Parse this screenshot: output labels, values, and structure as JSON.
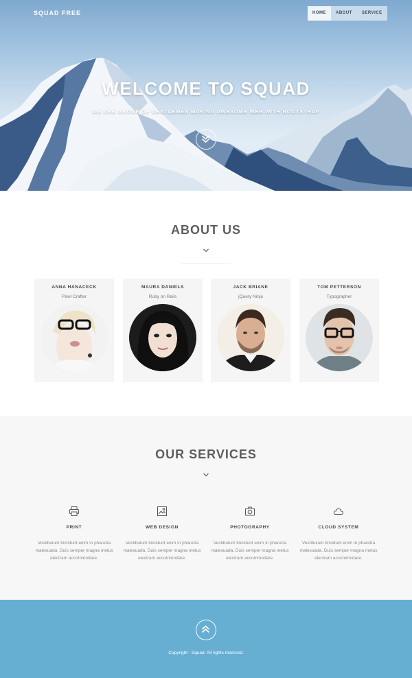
{
  "header": {
    "brand": "SQUAD FREE",
    "nav": [
      {
        "label": "HOME",
        "active": true
      },
      {
        "label": "ABOUT",
        "active": false
      },
      {
        "label": "SERVICE",
        "active": false
      }
    ]
  },
  "hero": {
    "title": "WELCOME TO SQUAD",
    "subtitle": "WE ARE GROUP OF GENTLEMEN MAKING AWESOME WEB WITH BOOTSTRAP",
    "scroll_icon": "double-chevron-down-icon"
  },
  "about": {
    "title": "ABOUT US",
    "team": [
      {
        "name": "ANNA HANACECK",
        "role": "Pixel Crafter"
      },
      {
        "name": "MAURA DANIELS",
        "role": "Ruby on Rails"
      },
      {
        "name": "JACK BRIANE",
        "role": "jQuery Ninja"
      },
      {
        "name": "TOM PETTERSON",
        "role": "Typographer"
      }
    ]
  },
  "services": {
    "title": "OUR SERVICES",
    "items": [
      {
        "title": "PRINT",
        "icon": "printer-icon",
        "text": [
          "Vestibulum tincidunt enim in pharetra",
          "malesuada. Duis semper magna metus",
          "electram accommodare."
        ]
      },
      {
        "title": "WEB DESIGN",
        "icon": "image-icon",
        "text": [
          "Vestibulum tincidunt enim in pharetra",
          "malesuada. Duis semper magna metus",
          "electram accommodare."
        ]
      },
      {
        "title": "PHOTOGRAPHY",
        "icon": "camera-icon",
        "text": [
          "Vestibulum tincidunt enim in pharetra",
          "malesuada. Duis semper magna metus",
          "electram accommodare."
        ]
      },
      {
        "title": "CLOUD SYSTEM",
        "icon": "cloud-icon",
        "text": [
          "Vestibulum tincidunt enim in pharetra",
          "malesuada. Duis semper magna metus",
          "electram accommodare."
        ]
      }
    ]
  },
  "footer": {
    "copyright": "Copyright - Squad. All rights reserved.",
    "up_icon": "double-chevron-up-icon"
  },
  "colors": {
    "footer_bg": "#67aed3",
    "services_bg": "#f7f7f7",
    "card_bg": "#f5f5f5",
    "title": "#5d5d5d"
  }
}
